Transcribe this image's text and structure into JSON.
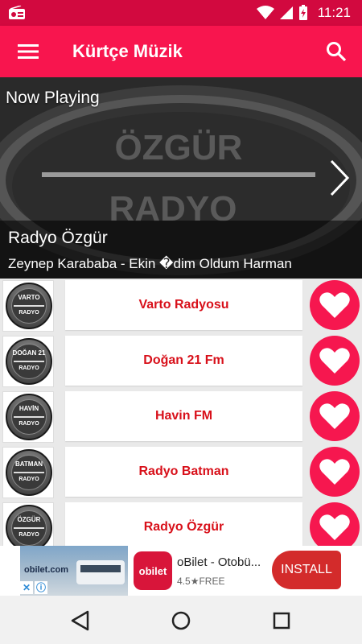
{
  "status_bar": {
    "time": "11:21"
  },
  "app_bar": {
    "title": "Kürtçe Müzik"
  },
  "now_playing": {
    "heading": "Now Playing",
    "station": "Radyo Özgür",
    "track": "Zeynep Karababa  -  Ekin �dim Oldum Harman",
    "art_text_top": "ÖZGÜR",
    "art_text_bottom": "RADYO"
  },
  "stations": [
    {
      "name": "Varto Radyosu",
      "logo_top": "VARTO",
      "logo_bottom": "RADYO"
    },
    {
      "name": "Doğan 21 Fm",
      "logo_top": "DOĞAN 21",
      "logo_bottom": "RADYO"
    },
    {
      "name": "Havin FM",
      "logo_top": "HAVİN",
      "logo_bottom": "RADYO"
    },
    {
      "name": "Radyo Batman",
      "logo_top": "BATMAN",
      "logo_bottom": "RADYO"
    },
    {
      "name": "Radyo Özgür",
      "logo_top": "ÖZGÜR",
      "logo_bottom": "RADYO"
    }
  ],
  "ad": {
    "image_brand": "obilet.com",
    "app_icon_text": "obilet",
    "title": "oBilet - Otobü...",
    "rating": "4.5",
    "price": "FREE",
    "install_label": "INSTALL"
  },
  "colors": {
    "accent": "#f8154e",
    "status": "#d2093f",
    "station_text": "#d8101a"
  }
}
